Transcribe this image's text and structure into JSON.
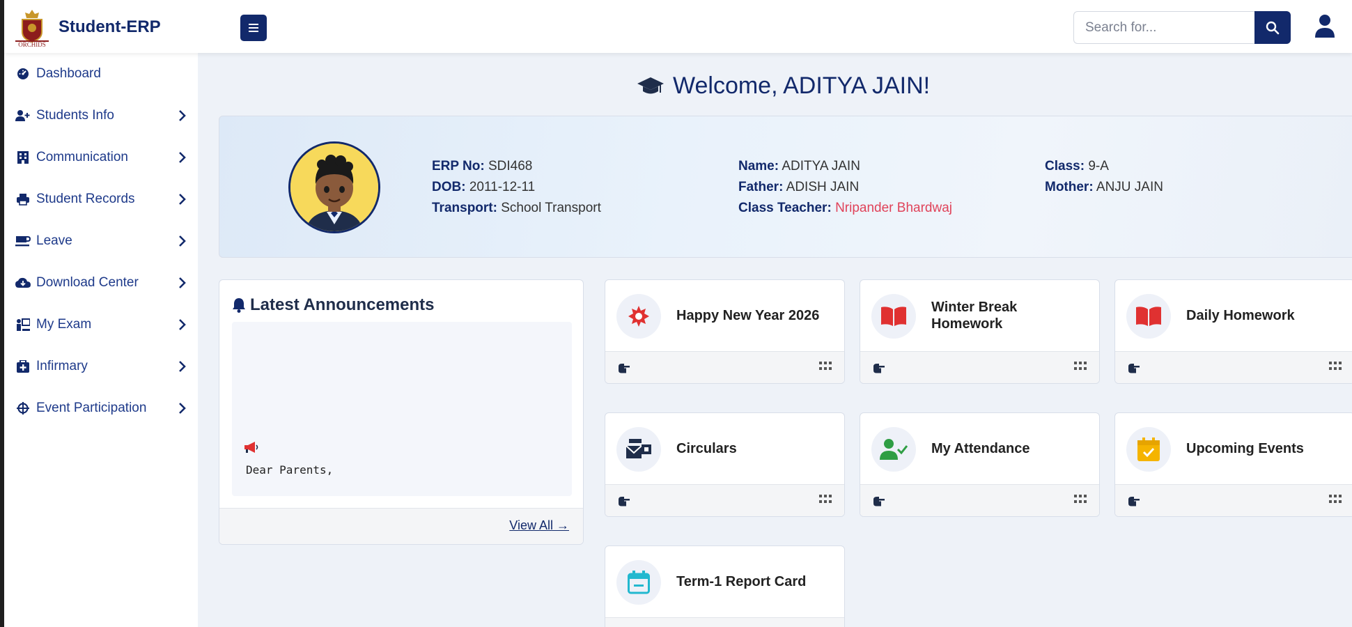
{
  "app": {
    "title": "Student-ERP"
  },
  "search": {
    "placeholder": "Search for..."
  },
  "sidebar": {
    "items": [
      {
        "label": "Dashboard",
        "icon": "tachometer-icon",
        "has_chevron": false
      },
      {
        "label": "Students Info",
        "icon": "user-plus-icon",
        "has_chevron": true
      },
      {
        "label": "Communication",
        "icon": "building-icon",
        "has_chevron": true
      },
      {
        "label": "Student Records",
        "icon": "printer-icon",
        "has_chevron": true
      },
      {
        "label": "Leave",
        "icon": "coffee-icon",
        "has_chevron": true
      },
      {
        "label": "Download Center",
        "icon": "cloud-download-icon",
        "has_chevron": true
      },
      {
        "label": "My Exam",
        "icon": "chalkboard-teacher-icon",
        "has_chevron": true
      },
      {
        "label": "Infirmary",
        "icon": "medkit-icon",
        "has_chevron": true
      },
      {
        "label": "Event Participation",
        "icon": "crosshairs-icon",
        "has_chevron": true
      }
    ]
  },
  "welcome": {
    "text": "Welcome, ADITYA JAIN!",
    "icon": "graduation-cap-icon"
  },
  "profile": {
    "erp_label": "ERP No:",
    "erp_value": "SDI468",
    "dob_label": "DOB:",
    "dob_value": "2011-12-11",
    "transport_label": "Transport:",
    "transport_value": "School Transport",
    "name_label": "Name:",
    "name_value": "ADITYA JAIN",
    "father_label": "Father:",
    "father_value": "ADISH JAIN",
    "teacher_label": "Class Teacher:",
    "teacher_value": "Nripander Bhardwaj",
    "class_label": "Class:",
    "class_value": "9-A",
    "mother_label": "Mother:",
    "mother_value": "ANJU JAIN"
  },
  "announcements": {
    "title": "Latest Announcements",
    "message": "Dear Parents,",
    "view_all": "View All →"
  },
  "cards": [
    {
      "title": "Happy New Year 2026",
      "icon": "sun-burst-icon",
      "color": "#e03131"
    },
    {
      "title": "Winter Break Homework",
      "icon": "book-open-icon",
      "color": "#e03131"
    },
    {
      "title": "Daily Homework",
      "icon": "book-open-icon",
      "color": "#e03131"
    },
    {
      "title": "Circulars",
      "icon": "mail-bulk-icon",
      "color": "#1f2d4a"
    },
    {
      "title": "My Attendance",
      "icon": "user-check-icon",
      "color": "#2f9e44"
    },
    {
      "title": "Upcoming Events",
      "icon": "calendar-check-icon",
      "color": "#f5b400"
    },
    {
      "title": "Term-1 Report Card",
      "icon": "calendar-minus-icon",
      "color": "#22b8cf"
    }
  ],
  "colors": {
    "brand": "#12296b",
    "accent_red": "#e0435a",
    "background": "#eef2f8"
  }
}
